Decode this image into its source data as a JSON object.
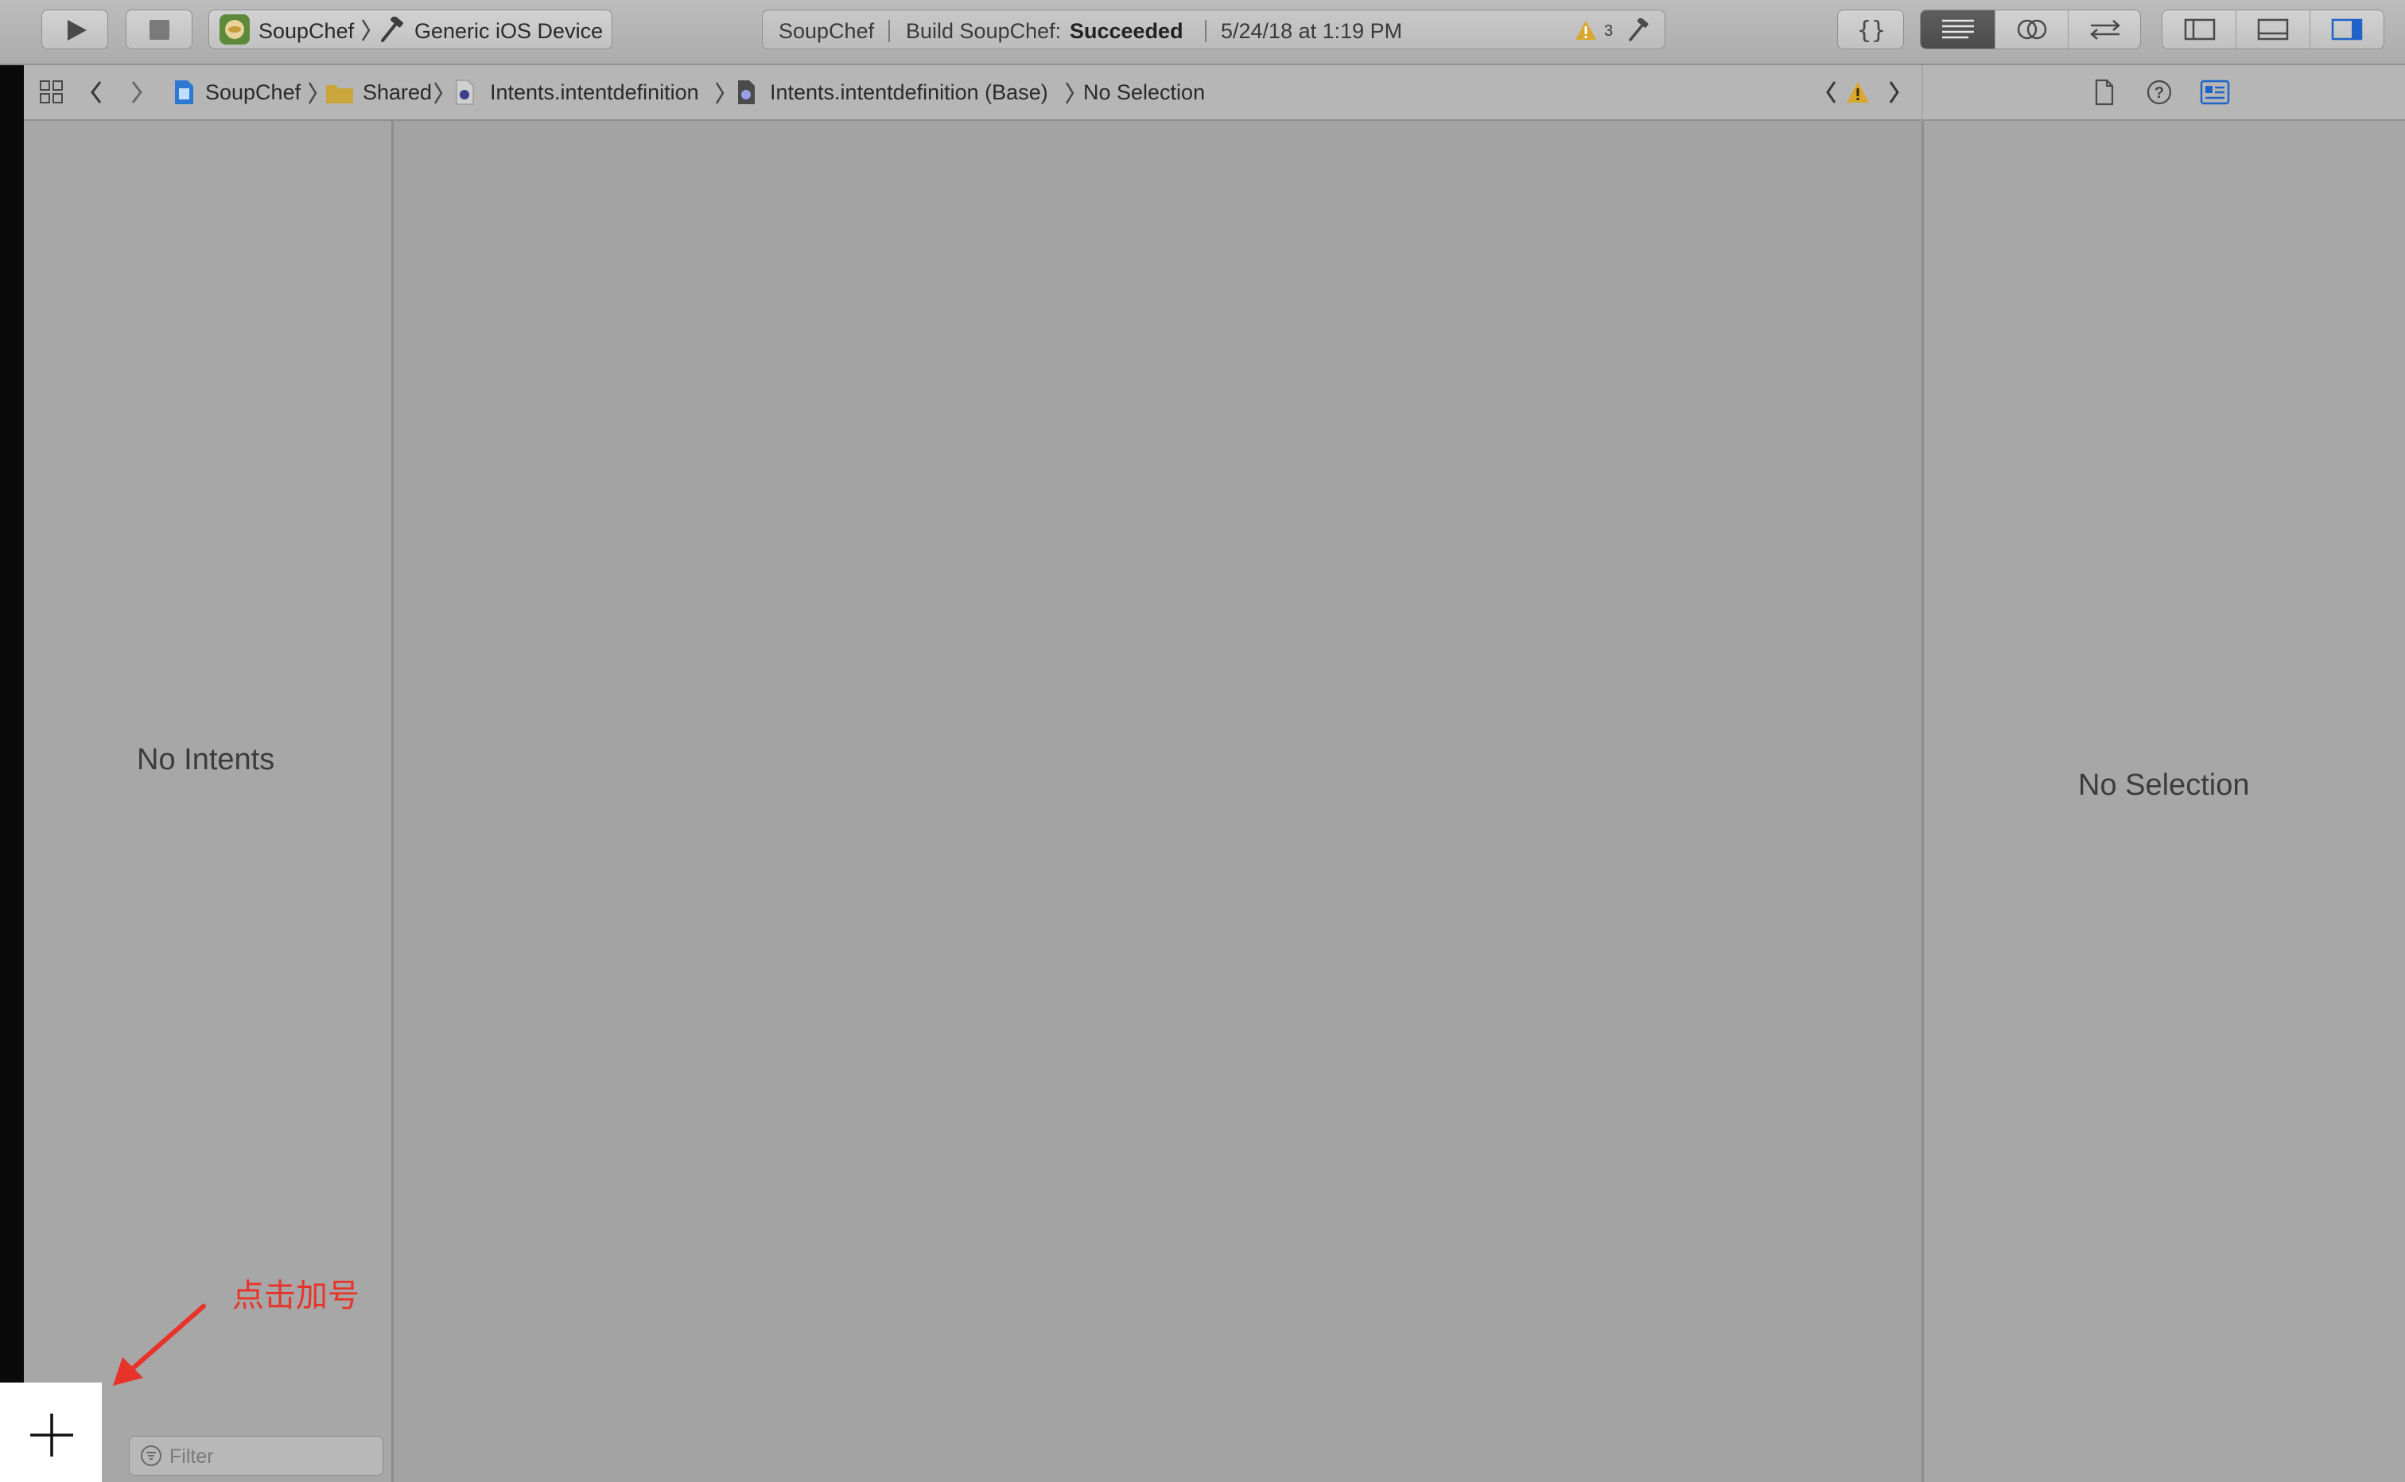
{
  "toolbar": {
    "scheme": {
      "app": "SoupChef",
      "device": "Generic iOS Device"
    },
    "activity": {
      "project": "SoupChef",
      "status_prefix": "Build SoupChef:",
      "status_result": "Succeeded",
      "timestamp": "5/24/18 at 1:19 PM",
      "warning_count": "3"
    }
  },
  "jumpbar": {
    "crumbs": [
      "SoupChef",
      "Shared",
      "Intents.intentdefinition",
      "Intents.intentdefinition (Base)",
      "No Selection"
    ]
  },
  "intent_list": {
    "empty_message": "No Intents",
    "filter_placeholder": "Filter"
  },
  "inspector": {
    "empty_message": "No Selection"
  },
  "annotation": {
    "text": "点击加号",
    "color": "#e8332a"
  },
  "icons": {
    "run": "play-icon",
    "stop": "stop-icon",
    "add": "plus-icon",
    "warning": "warning-triangle-icon",
    "build": "hammer-icon"
  }
}
